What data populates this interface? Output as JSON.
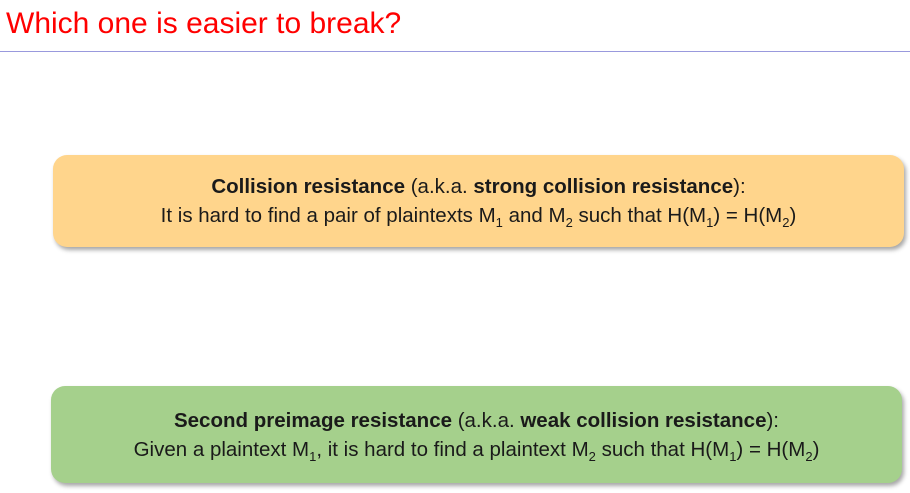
{
  "slide": {
    "title": "Which one is easier to break?"
  },
  "collision_box": {
    "heading_bold": "Collision resistance",
    "heading_aka": " (a.k.a. ",
    "heading_alt_bold": "strong collision resistance",
    "heading_close": "):",
    "body_part1": "It is hard to find a pair of plaintexts M",
    "sub_1": "1",
    "body_part2": " and M",
    "sub_2": "2",
    "body_part3": " such that H(M",
    "sub_3": "1",
    "body_part4": ") = H(M",
    "sub_4": "2",
    "body_part5": ")",
    "color": "#ffd58c"
  },
  "preimage_box": {
    "heading_bold": "Second preimage resistance",
    "heading_aka": " (a.k.a. ",
    "heading_alt_bold": "weak collision resistance",
    "heading_close": "):",
    "body_part1": "Given a plaintext M",
    "sub_1": "1",
    "body_part2": ", it is hard to find a plaintext M",
    "sub_2": "2",
    "body_part3": " such that H(M",
    "sub_3": "1",
    "body_part4": ") = H(M",
    "sub_4": "2",
    "body_part5": ")",
    "color": "#a5d08c"
  },
  "colors": {
    "title": "#ff0000",
    "rule": "#9999dd",
    "text": "#1a1a1a"
  }
}
